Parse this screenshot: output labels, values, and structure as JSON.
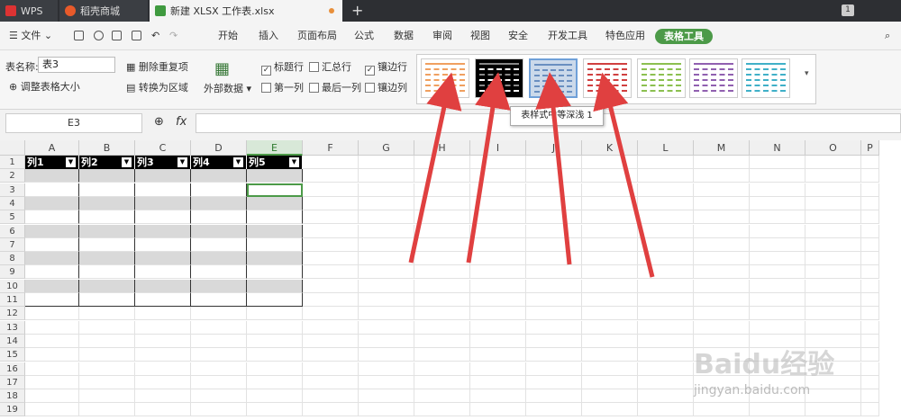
{
  "tabs": [
    {
      "label": "WPS"
    },
    {
      "label": "稻壳商城"
    },
    {
      "label": "新建 XLSX 工作表.xlsx"
    }
  ],
  "new_tab": "+",
  "window_count": "1",
  "menu": {
    "file": "文件",
    "items": [
      "开始",
      "插入",
      "页面布局",
      "公式",
      "数据",
      "审阅",
      "视图",
      "安全",
      "开发工具",
      "特色应用"
    ],
    "table_tools": "表格工具"
  },
  "ribbon": {
    "table_name_label": "表名称:",
    "table_name_value": "表3",
    "resize_table": "调整表格大小",
    "remove_duplicates": "删除重复项",
    "convert_to_range": "转换为区域",
    "external_data": "外部数据",
    "options": [
      {
        "label": "标题行",
        "checked": true
      },
      {
        "label": "汇总行",
        "checked": false
      },
      {
        "label": "镶边行",
        "checked": true
      },
      {
        "label": "第一列",
        "checked": false
      },
      {
        "label": "最后一列",
        "checked": false
      },
      {
        "label": "镶边列",
        "checked": false
      }
    ],
    "styles": [
      {
        "color": "#f0a060"
      },
      {
        "color": "#000000"
      },
      {
        "color": "#6a8fc0"
      },
      {
        "color": "#d04040"
      },
      {
        "color": "#8cc050"
      },
      {
        "color": "#9060b0"
      },
      {
        "color": "#40b0c8"
      }
    ]
  },
  "tooltip": "表样式中等深浅 1",
  "name_box": "E3",
  "fx": "fx",
  "columns": [
    "A",
    "B",
    "C",
    "D",
    "E",
    "F",
    "G",
    "H",
    "I",
    "J",
    "K",
    "L",
    "M",
    "N",
    "O",
    "P"
  ],
  "rows": [
    "1",
    "2",
    "3",
    "4",
    "5",
    "6",
    "7",
    "8",
    "9",
    "10",
    "11",
    "12",
    "13",
    "14",
    "15",
    "16",
    "17",
    "18",
    "19"
  ],
  "table_headers": [
    "列1",
    "列2",
    "列3",
    "列4",
    "列5"
  ],
  "watermark": "Baidu经验",
  "watermark_url": "jingyan.baidu.com",
  "colors": {
    "accent": "#4c9a48",
    "arrow": "#e04040",
    "band": "#d9d9d9"
  }
}
